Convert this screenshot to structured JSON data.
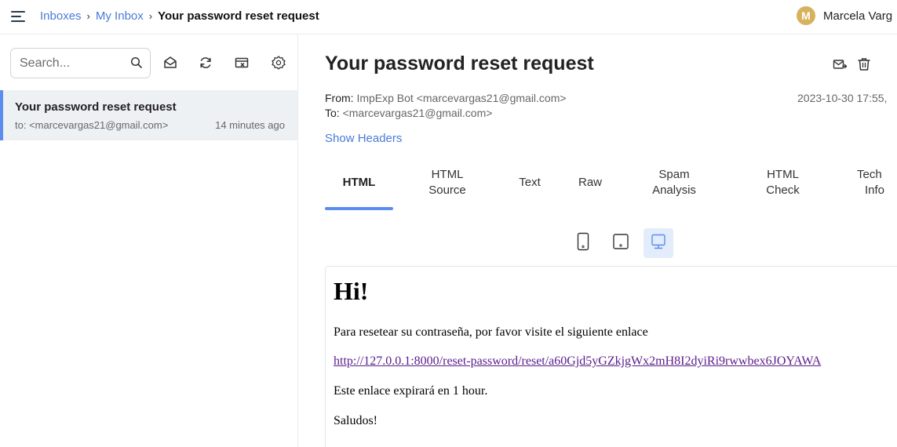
{
  "topbar": {
    "breadcrumb": [
      "Inboxes",
      "My Inbox",
      "Your password reset request"
    ],
    "separator": "›",
    "user_initial": "M",
    "user_name": "Marcela Varg"
  },
  "sidebar": {
    "search_placeholder": "Search...",
    "messages": [
      {
        "subject": "Your password reset request",
        "to": "to: <marcevargas21@gmail.com>",
        "time": "14 minutes ago"
      }
    ]
  },
  "email": {
    "title": "Your password reset request",
    "from_label": "From:",
    "from_value": "ImpExp Bot <marcevargas21@gmail.com>",
    "to_label": "To:",
    "to_value": "<marcevargas21@gmail.com>",
    "date": "2023-10-30 17:55,",
    "show_headers": "Show Headers",
    "tabs": [
      {
        "line1": "HTML",
        "line2": ""
      },
      {
        "line1": "HTML",
        "line2": "Source"
      },
      {
        "line1": "Text",
        "line2": ""
      },
      {
        "line1": "Raw",
        "line2": ""
      },
      {
        "line1": "Spam",
        "line2": "Analysis"
      },
      {
        "line1": "HTML",
        "line2": "Check"
      },
      {
        "line1": "Tech",
        "line2": "Info"
      }
    ],
    "active_tab": "HTML"
  },
  "preview": {
    "heading": "Hi!",
    "line1": "Para resetear su contraseña, por favor visite el siguiente enlace",
    "link": "http://127.0.0.1:8000/reset-password/reset/a60Gjd5yGZkjgWx2mH8I2dyiRi9rwwbex6JOYAWA",
    "line2": "Este enlace expirará en 1 hour.",
    "line3": "Saludos!"
  },
  "colors": {
    "accent": "#5b8def",
    "link": "#4a7bd8",
    "avatar": "#d8b15c",
    "selected_row": "#eef1f4"
  },
  "icons": [
    "menu-icon",
    "search-icon",
    "mark-read-icon",
    "refresh-icon",
    "clear-inbox-icon",
    "settings-icon",
    "forward-icon",
    "trash-icon",
    "mobile-view-icon",
    "tablet-view-icon",
    "desktop-view-icon"
  ]
}
